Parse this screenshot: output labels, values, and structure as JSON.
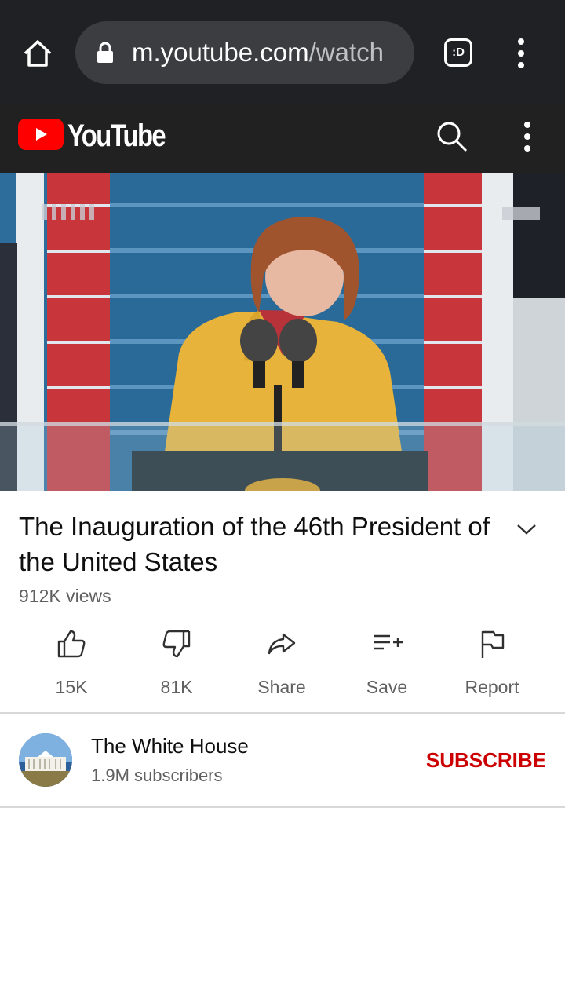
{
  "browser": {
    "url_host": "m.youtube.com",
    "url_rest": "/watch",
    "tabs_label": ":D"
  },
  "youtube": {
    "logo_text": "YouTube"
  },
  "video": {
    "title": "The Inauguration of the 46th President of the United States",
    "views": "912K views"
  },
  "actions": {
    "like": "15K",
    "dislike": "81K",
    "share": "Share",
    "save": "Save",
    "report": "Report"
  },
  "channel": {
    "name": "The White House",
    "subscribers": "1.9M subscribers",
    "subscribe_label": "SUBSCRIBE"
  },
  "colors": {
    "browser_bg": "#202124",
    "yt_header_bg": "#212121",
    "yt_red": "#ff0000",
    "subscribe_red": "#cc0000"
  }
}
